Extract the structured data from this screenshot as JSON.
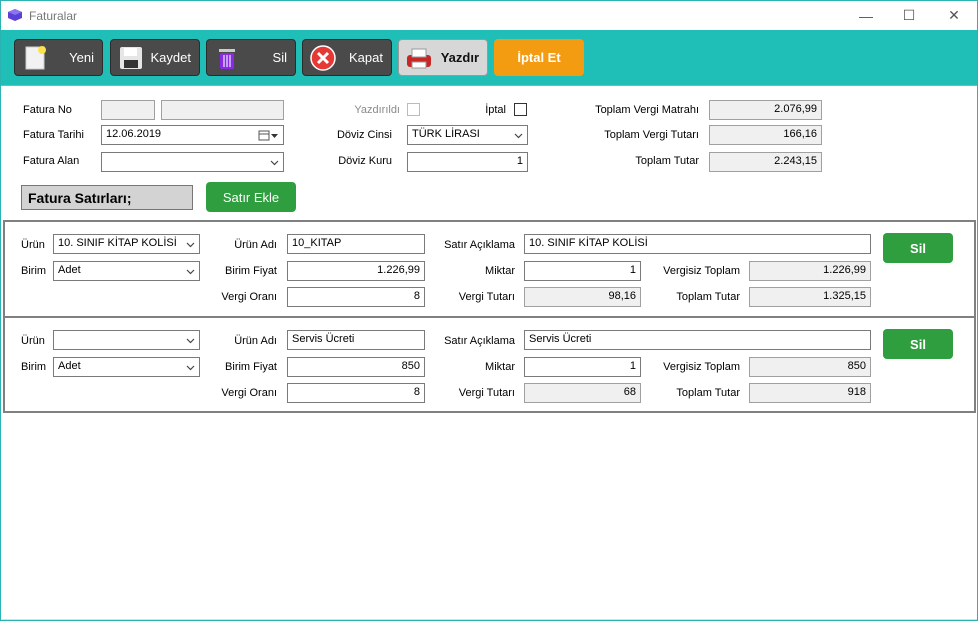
{
  "window": {
    "title": "Faturalar",
    "min_glyph": "—",
    "max_glyph": "☐",
    "close_glyph": "✕"
  },
  "toolbar": {
    "yeni": "Yeni",
    "kaydet": "Kaydet",
    "sil": "Sil",
    "kapat": "Kapat",
    "yazdir": "Yazdır",
    "iptal_et": "İptal Et"
  },
  "header": {
    "fatura_no_label": "Fatura No",
    "fatura_no_value_1": "",
    "fatura_no_value_2": "",
    "fatura_tarihi_label": "Fatura Tarihi",
    "fatura_tarihi_value": "12.06.2019",
    "fatura_alan_label": "Fatura Alan",
    "fatura_alan_value": "",
    "yazdirildi_label": "Yazdırıldı",
    "iptal_label": "İptal",
    "doviz_cinsi_label": "Döviz Cinsi",
    "doviz_cinsi_value": "TÜRK LİRASI",
    "doviz_kuru_label": "Döviz Kuru",
    "doviz_kuru_value": "1",
    "toplam_vergi_matrahi_label": "Toplam Vergi Matrahı",
    "toplam_vergi_matrahi_value": "2.076,99",
    "toplam_vergi_tutari_label": "Toplam Vergi Tutarı",
    "toplam_vergi_tutari_value": "166,16",
    "toplam_tutar_label": "Toplam Tutar",
    "toplam_tutar_value": "2.243,15"
  },
  "section": {
    "title": "Fatura Satırları;",
    "add_line": "Satır Ekle"
  },
  "labels": {
    "urun": "Ürün",
    "birim": "Birim",
    "urun_adi": "Ürün Adı",
    "birim_fiyat": "Birim Fiyat",
    "vergi_orani": "Vergi Oranı",
    "satir_aciklama": "Satır Açıklama",
    "miktar": "Miktar",
    "vergi_tutari": "Vergi Tutarı",
    "vergisiz_toplam": "Vergisiz Toplam",
    "toplam_tutar": "Toplam Tutar",
    "sil": "Sil"
  },
  "lines": [
    {
      "urun": "10. SINIF KİTAP KOLİSİ",
      "birim": "Adet",
      "urun_adi": "10_KITAP",
      "birim_fiyat": "1.226,99",
      "vergi_orani": "8",
      "satir_aciklama": "10. SINIF KİTAP KOLİSİ",
      "miktar": "1",
      "vergi_tutari": "98,16",
      "vergisiz_toplam": "1.226,99",
      "toplam_tutar": "1.325,15"
    },
    {
      "urun": "",
      "birim": "Adet",
      "urun_adi": "Servis Ücreti",
      "birim_fiyat": "850",
      "vergi_orani": "8",
      "satir_aciklama": "Servis Ücreti",
      "miktar": "1",
      "vergi_tutari": "68",
      "vergisiz_toplam": "850",
      "toplam_tutar": "918"
    }
  ],
  "colors": {
    "toolbar_bg": "#1fbfb8",
    "button_dark": "#4a4a4a",
    "button_orange": "#f39c12",
    "button_green": "#2e9e3f"
  }
}
